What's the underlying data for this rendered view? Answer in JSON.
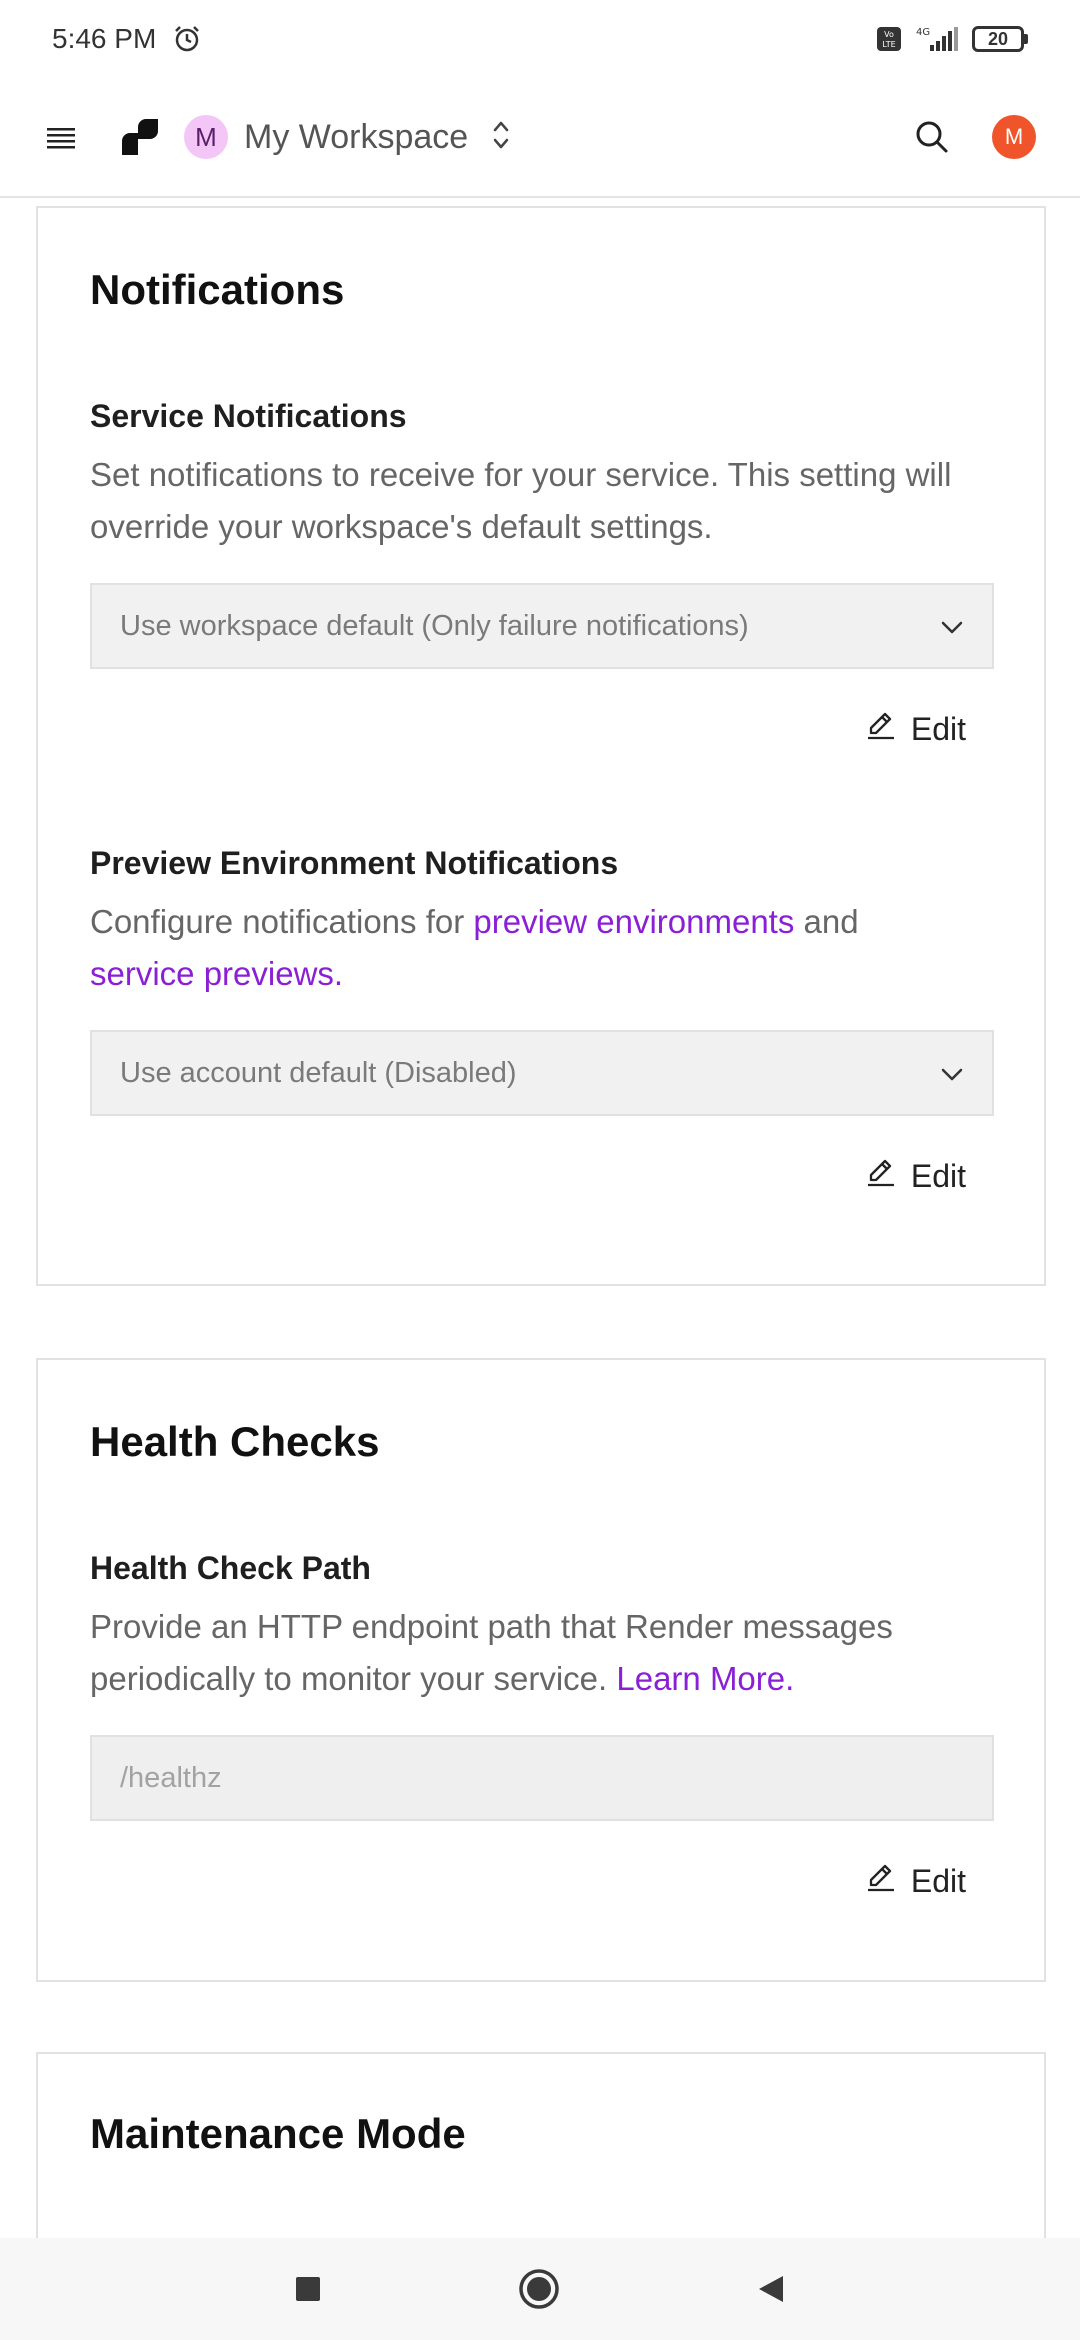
{
  "status_bar": {
    "time": "5:46 PM",
    "alarm_icon": "alarm-icon",
    "volte_label": "Vo LTE",
    "network_label": "4G",
    "battery_level": "20"
  },
  "header": {
    "menu_icon": "menu-icon",
    "logo_icon": "render-logo-icon",
    "workspace_initial": "M",
    "workspace_name": "My Workspace",
    "search_icon": "search-icon",
    "user_initial": "M",
    "colors": {
      "workspace_avatar_bg": "#f3c6f7",
      "user_avatar_bg": "#f0542a"
    }
  },
  "notifications": {
    "title": "Notifications",
    "service": {
      "title": "Service Notifications",
      "description": "Set notifications to receive for your service. This setting will override your workspace's default settings.",
      "selected_option": "Use workspace default (Only failure notifications)",
      "edit_label": "Edit"
    },
    "preview": {
      "title": "Preview Environment Notifications",
      "desc_prefix": "Configure notifications for ",
      "link_preview_environments": "preview environments",
      "desc_middle": " and ",
      "link_service_previews": "service previews.",
      "selected_option": "Use account default (Disabled)",
      "edit_label": "Edit"
    }
  },
  "health_checks": {
    "title": "Health Checks",
    "path": {
      "title": "Health Check Path",
      "desc_text": "Provide an HTTP endpoint path that Render messages periodically to monitor your service. ",
      "learn_more": "Learn More.",
      "placeholder": "/healthz",
      "edit_label": "Edit"
    }
  },
  "maintenance": {
    "title": "Maintenance Mode"
  },
  "nav_bar": {
    "recents_icon": "square-icon",
    "home_icon": "circle-home-icon",
    "back_icon": "triangle-back-icon"
  },
  "colors": {
    "link": "#8a1fd6",
    "accent_avatar": "#f0542a"
  }
}
